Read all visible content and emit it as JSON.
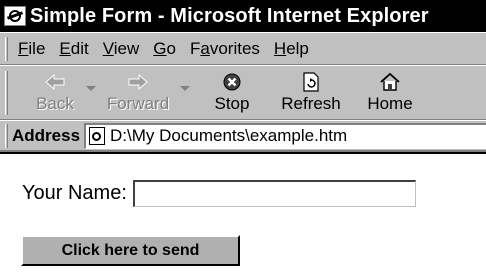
{
  "window": {
    "title": "Simple Form - Microsoft Internet Explorer"
  },
  "menu": {
    "items": [
      {
        "label": "File",
        "mnemonic": "F"
      },
      {
        "label": "Edit",
        "mnemonic": "E"
      },
      {
        "label": "View",
        "mnemonic": "V"
      },
      {
        "label": "Go",
        "mnemonic": "G"
      },
      {
        "label": "Favorites",
        "mnemonic": "a"
      },
      {
        "label": "Help",
        "mnemonic": "H"
      }
    ]
  },
  "toolbar": {
    "back": {
      "label": "Back",
      "icon": "left-arrow-icon",
      "enabled": false
    },
    "forward": {
      "label": "Forward",
      "icon": "right-arrow-icon",
      "enabled": false
    },
    "stop": {
      "label": "Stop",
      "icon": "stop-icon"
    },
    "refresh": {
      "label": "Refresh",
      "icon": "refresh-icon"
    },
    "home": {
      "label": "Home",
      "icon": "home-icon"
    }
  },
  "address": {
    "label": "Address",
    "value": "D:\\My Documents\\example.htm",
    "icon": "page-icon"
  },
  "form": {
    "name_label": "Your Name:",
    "name_value": "",
    "submit_label": "Click here to send"
  },
  "colors": {
    "titlebar": "#000000",
    "chrome": "#c0c0c0",
    "button_face": "#b0b0b0",
    "disabled_text": "#808080"
  }
}
